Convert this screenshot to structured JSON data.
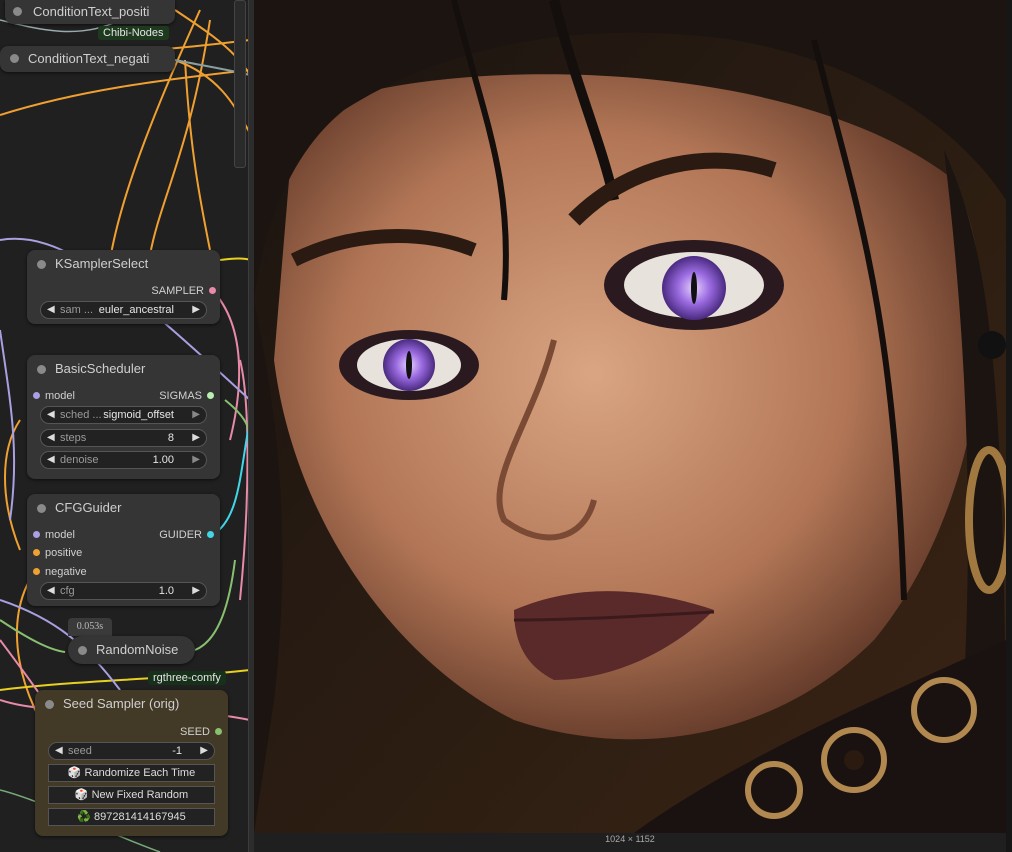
{
  "nodes": {
    "cond_pos": {
      "title": "ConditionText_positi"
    },
    "cond_neg": {
      "title": "ConditionText_negati"
    },
    "chibi_tag": "Chibi-Nodes",
    "ksampler_select": {
      "title": "KSamplerSelect",
      "output": "SAMPLER",
      "widget_label": "sam ...",
      "widget_value": "euler_ancestral"
    },
    "basic_scheduler": {
      "title": "BasicScheduler",
      "input": "model",
      "output": "SIGMAS",
      "widgets": [
        {
          "label": "sched ...",
          "value": "sigmoid_offset"
        },
        {
          "label": "steps",
          "value": "8"
        },
        {
          "label": "denoise",
          "value": "1.00"
        }
      ]
    },
    "cfg_guider": {
      "title": "CFGGuider",
      "inputs": [
        "model",
        "positive",
        "negative"
      ],
      "output": "GUIDER",
      "widget_label": "cfg",
      "widget_value": "1.0"
    },
    "timing": "0.053s",
    "random_noise": {
      "title": "RandomNoise"
    },
    "rgthree_tag": "rgthree-comfy",
    "seed_sampler": {
      "title": "Seed Sampler (orig)",
      "output": "SEED",
      "widget_label": "seed",
      "widget_value": "-1",
      "buttons": [
        "🎲 Randomize Each Time",
        "🎲 New Fixed Random",
        "♻️ 897281414167945"
      ]
    }
  },
  "preview": {
    "size_label": "1024 × 1152",
    "subject": "portrait-image"
  },
  "colors": {
    "wire_orange": "#f0a030",
    "wire_yellow": "#e8d020",
    "wire_pink": "#e88aa8",
    "wire_lavender": "#a8a0e0",
    "wire_cyan": "#40d8e8",
    "wire_green": "#88c070",
    "eye_violet": "#9a6ae0"
  }
}
